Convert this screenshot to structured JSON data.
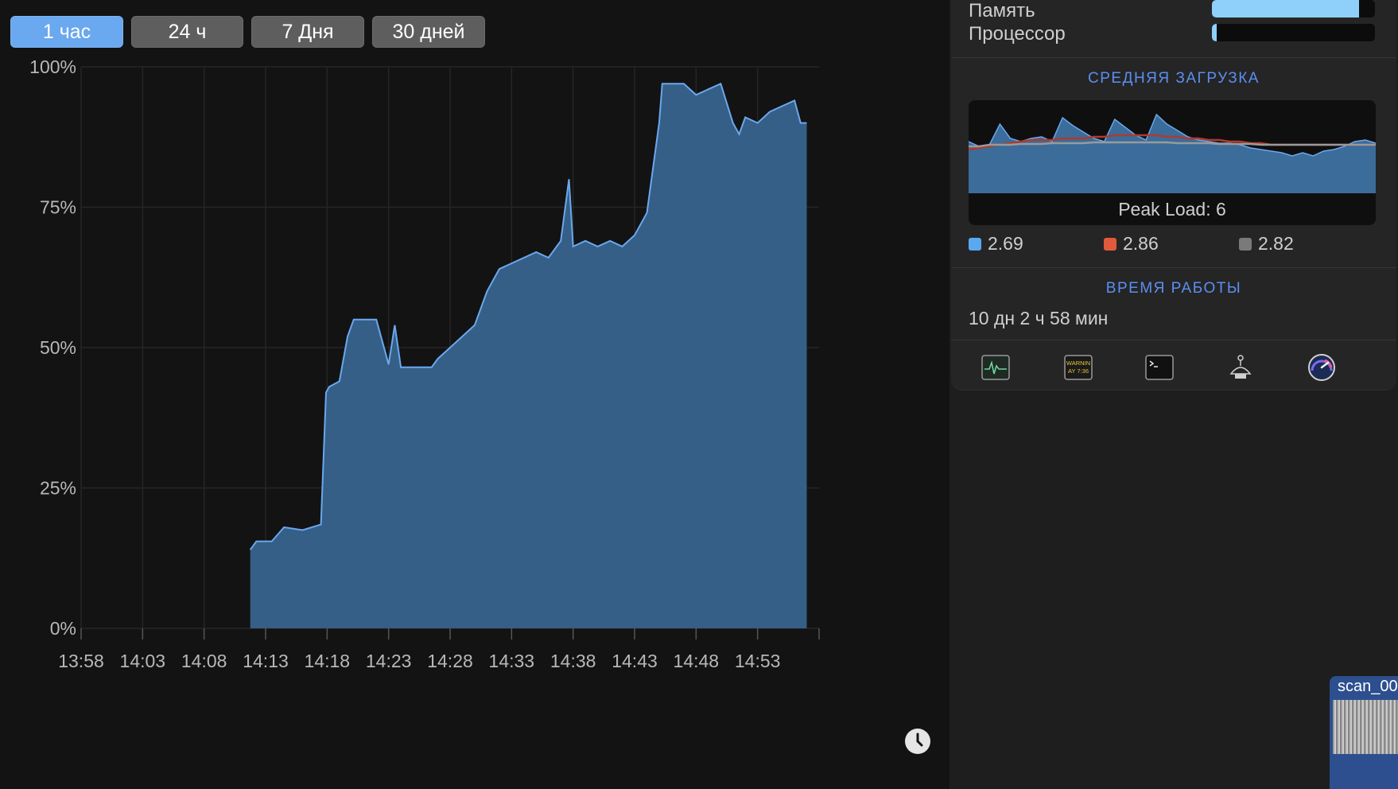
{
  "time_range": {
    "buttons": [
      "1 час",
      "24 ч",
      "7 Дня",
      "30 дней"
    ],
    "selected": "1 час"
  },
  "chart_data": {
    "type": "area",
    "title": "",
    "xlabel": "",
    "ylabel": "",
    "y_ticks": [
      "100%",
      "75%",
      "50%",
      "25%",
      "0%"
    ],
    "x_ticks": [
      "13:58",
      "14:03",
      "14:08",
      "14:13",
      "14:18",
      "14:23",
      "14:28",
      "14:33",
      "14:38",
      "14:43",
      "14:48",
      "14:53"
    ],
    "ylim": [
      0,
      100
    ],
    "series": [
      {
        "x": [
          "14:11:45",
          "14:12:15",
          "14:13:30",
          "14:14:30",
          "14:16:00",
          "14:17:30",
          "14:17:55",
          "14:18:10",
          "14:19:00",
          "14:19:40",
          "14:20:10",
          "14:21:00",
          "14:22:00",
          "14:23:00",
          "14:23:30",
          "14:24:00",
          "14:25:00",
          "14:26:30",
          "14:27:00",
          "14:28:00",
          "14:29:00",
          "14:30:00",
          "14:31:00",
          "14:31:30",
          "14:32:00",
          "14:33:00",
          "14:34:00",
          "14:35:00",
          "14:36:00",
          "14:37:00",
          "14:37:40",
          "14:38:00",
          "14:39:00",
          "14:40:00",
          "14:41:00",
          "14:42:00",
          "14:43:00",
          "14:44:00",
          "14:45:00",
          "14:45:15",
          "14:46:00",
          "14:47:00",
          "14:48:00",
          "14:49:00",
          "14:50:00",
          "14:51:00",
          "14:51:30",
          "14:52:00",
          "14:53:00",
          "14:54:00",
          "14:55:00",
          "14:56:00",
          "14:56:30",
          "14:57:00"
        ],
        "values": [
          14,
          15.5,
          15.5,
          18,
          17.5,
          18.5,
          42,
          43,
          44,
          52,
          55,
          55,
          55,
          47,
          54,
          46.5,
          46.5,
          46.5,
          48,
          50,
          52,
          54,
          60,
          62,
          64,
          65,
          66,
          67,
          66,
          69,
          80,
          68,
          69,
          68,
          69,
          68,
          70,
          74,
          90,
          97,
          97,
          97,
          95,
          96,
          97,
          90,
          88,
          91,
          90,
          92,
          93,
          94,
          90,
          90
        ],
        "color": "#6aa8ef"
      }
    ]
  },
  "resources": {
    "memory": {
      "label": "Память",
      "fill": 0.9
    },
    "cpu": {
      "label": "Процессор",
      "fill": 0.03
    }
  },
  "load_average": {
    "title": "СРЕДНЯЯ ЗАГРУЗКА",
    "peak_label": "Peak Load: 6",
    "legend": [
      {
        "value": "2.69",
        "color": "#5aa9f0"
      },
      {
        "value": "2.86",
        "color": "#e05a3c"
      },
      {
        "value": "2.82",
        "color": "#7a7a7a"
      }
    ]
  },
  "uptime": {
    "title": "ВРЕМЯ РАБОТЫ",
    "value": "10 дн 2 ч 58 мин"
  },
  "toolbar_icons": [
    "activity-monitor-icon",
    "console-icon",
    "terminal-icon",
    "disk-utility-icon",
    "istat-icon"
  ],
  "console_icon_text": [
    "WARNIN",
    "AY 7:36"
  ],
  "scan_thumbnail": {
    "label": "scan_00"
  }
}
